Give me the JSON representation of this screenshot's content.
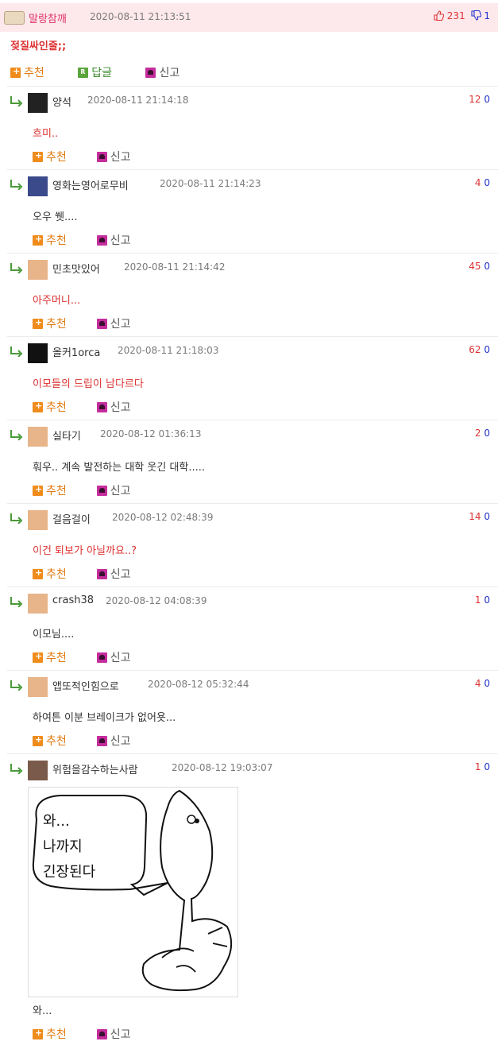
{
  "post": {
    "nick": "말랑참깨",
    "date": "2020-08-11 21:13:51",
    "up": "231",
    "down": "1",
    "text": "젖질싸인줄;;"
  },
  "actions": {
    "recommend": "추천",
    "reply": "답글",
    "report": "신고"
  },
  "comments": [
    {
      "nick": "양석",
      "date": "2020-08-11 21:14:18",
      "up": "12",
      "down": "0",
      "text": "흐미..",
      "red": true
    },
    {
      "nick": "영화는영어로무비",
      "date": "2020-08-11 21:14:23",
      "up": "4",
      "down": "0",
      "text": "오우 쒯....",
      "red": false
    },
    {
      "nick": "민초맛있어",
      "date": "2020-08-11 21:14:42",
      "up": "45",
      "down": "0",
      "text": "아주머니...",
      "red": true
    },
    {
      "nick": "올커1orca",
      "date": "2020-08-11 21:18:03",
      "up": "62",
      "down": "0",
      "text": "이모들의 드립이 남다르다",
      "red": true
    },
    {
      "nick": "실타기",
      "date": "2020-08-12 01:36:13",
      "up": "2",
      "down": "0",
      "text": "훠우.. 계속 발전하는 대학 웃긴 대학.....",
      "red": false
    },
    {
      "nick": "걸음걸이",
      "date": "2020-08-12 02:48:39",
      "up": "14",
      "down": "0",
      "text": "이건 퇴보가 아닐까요..?",
      "red": true
    },
    {
      "nick": "crash38",
      "date": "2020-08-12 04:08:39",
      "up": "1",
      "down": "0",
      "text": "이모님....",
      "red": false
    },
    {
      "nick": "앱또적인힘으로",
      "date": "2020-08-12 05:32:44",
      "up": "4",
      "down": "0",
      "text": "하여튼 이분 브레이크가 없어욧...",
      "red": false
    },
    {
      "nick": "위험을감수하는사람",
      "date": "2020-08-12 19:03:07",
      "up": "1",
      "down": "0",
      "text": "와...",
      "red": false
    }
  ],
  "cartoon": {
    "line1": "와...",
    "line2": "나까지",
    "line3": "긴장된다"
  },
  "colors": {
    "accent": "#dd3333",
    "nick_pink": "#e0306a",
    "down_blue": "#2233cc"
  }
}
